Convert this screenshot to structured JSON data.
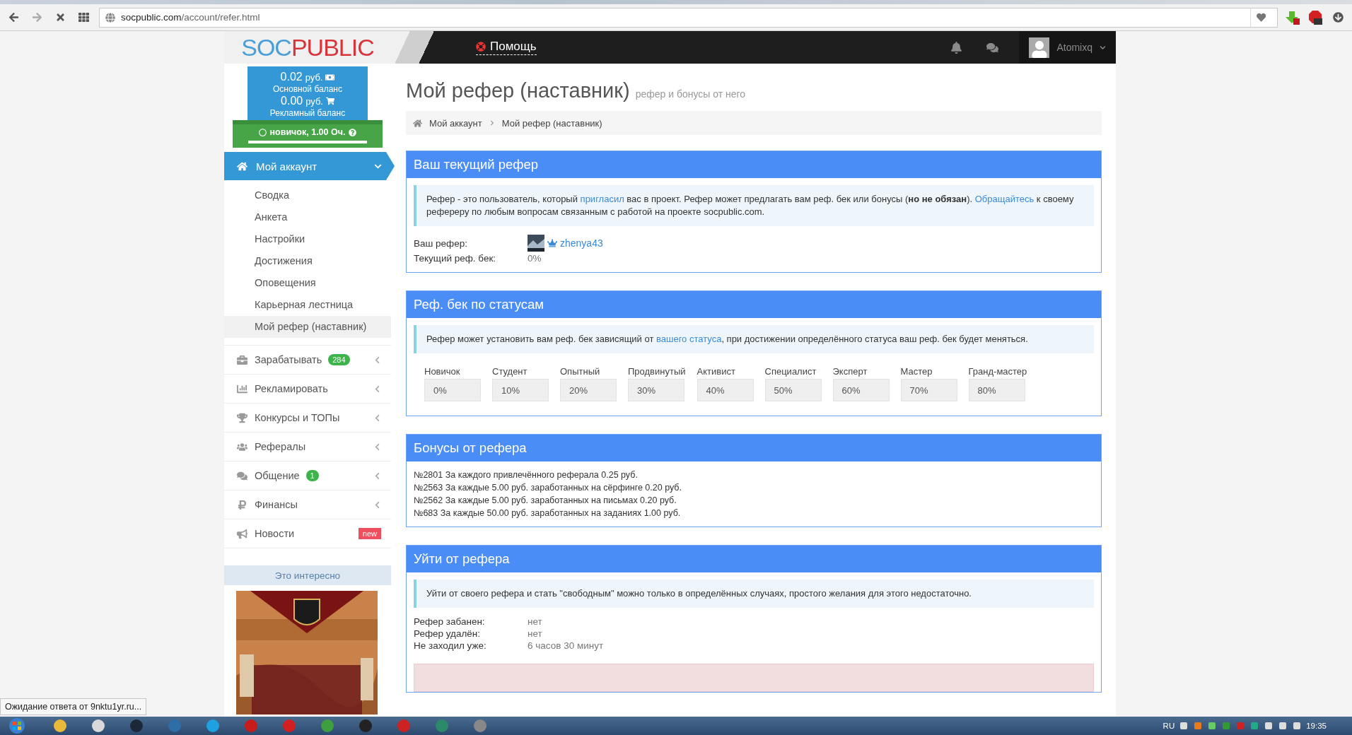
{
  "browser": {
    "url_host": "socpublic.com",
    "url_path": "/account/refer.html",
    "status_text": "Ожидание ответа от 9nktu1yr.ru..."
  },
  "header": {
    "logo_left": "SOC",
    "logo_right": "PUBLIC",
    "help": "Помощь",
    "user": "Atomixq"
  },
  "balance": {
    "main_amount": "0.02",
    "main_currency": "руб.",
    "main_label": "Основной баланс",
    "ad_amount": "0.00",
    "ad_currency": "руб.",
    "ad_label": "Рекламный баланс",
    "status": "новичок, 1.00 Оч.",
    "level": 1
  },
  "menu": {
    "account": {
      "label": "Мой аккаунт",
      "expanded": true
    },
    "subitems": [
      {
        "label": "Сводка",
        "selected": false
      },
      {
        "label": "Анкета",
        "selected": false
      },
      {
        "label": "Настройки",
        "selected": false
      },
      {
        "label": "Достижения",
        "selected": false
      },
      {
        "label": "Оповещения",
        "selected": false
      },
      {
        "label": "Карьерная лестница",
        "selected": false
      },
      {
        "label": "Мой рефер (наставник)",
        "selected": true
      }
    ],
    "items": [
      {
        "label": "Зарабатывать",
        "badge": {
          "text": "284",
          "kind": "count"
        },
        "has_submenu": true
      },
      {
        "label": "Рекламировать",
        "has_submenu": true
      },
      {
        "label": "Конкурсы и ТОПы",
        "has_submenu": true
      },
      {
        "label": "Рефералы",
        "has_submenu": true
      },
      {
        "label": "Общение",
        "badge": {
          "text": "1",
          "kind": "count"
        },
        "has_submenu": true
      },
      {
        "label": "Финансы",
        "has_submenu": true
      },
      {
        "label": "Новости",
        "badge": {
          "text": "new",
          "kind": "new"
        },
        "has_submenu": false
      }
    ]
  },
  "interest": {
    "title": "Это интересно"
  },
  "page": {
    "title": "Мой рефер (наставник)",
    "subtitle": "рефер и бонусы от него",
    "breadcrumb": [
      "Мой аккаунт",
      "Мой рефер (наставник)"
    ]
  },
  "panels": [
    {
      "title": "Ваш текущий рефер",
      "note": [
        {
          "kind": "text",
          "text": "Рефер - это пользователь, который "
        },
        {
          "kind": "link",
          "text": "пригласил"
        },
        {
          "kind": "text",
          "text": " вас в проект. Рефер может предлагать вам реф. бек или бонусы ("
        },
        {
          "kind": "bold",
          "text": "но не обязан"
        },
        {
          "kind": "text",
          "text": "). "
        },
        {
          "kind": "link",
          "text": "Обращайтесь"
        },
        {
          "kind": "text",
          "text": " к своему рефереру по любым вопросам связанным с работой на проекте socpublic.com."
        }
      ],
      "fields": [
        {
          "label": "Ваш рефер:",
          "value": "zhenya43",
          "kind": "user"
        },
        {
          "label": "Текущий реф. бек:",
          "value": "0%",
          "kind": "text"
        }
      ]
    },
    {
      "title": "Реф. бек по статусам",
      "note": [
        {
          "kind": "text",
          "text": "Рефер может установить вам реф. бек зависящий от "
        },
        {
          "kind": "link",
          "text": "вашего статуса"
        },
        {
          "kind": "text",
          "text": ", при достижении определённого статуса ваш реф. бек будет меняться."
        }
      ],
      "statuses": [
        {
          "name": "Новичок",
          "value": "0%"
        },
        {
          "name": "Студент",
          "value": "10%"
        },
        {
          "name": "Опытный",
          "value": "20%"
        },
        {
          "name": "Продвинутый",
          "value": "30%"
        },
        {
          "name": "Активист",
          "value": "40%"
        },
        {
          "name": "Специалист",
          "value": "50%"
        },
        {
          "name": "Эксперт",
          "value": "60%"
        },
        {
          "name": "Мастер",
          "value": "70%"
        },
        {
          "name": "Гранд-мастер",
          "value": "80%"
        }
      ]
    },
    {
      "title": "Бонусы от рефера",
      "bonuses": [
        "№2801 За каждого привлечённого реферала 0.25 руб.",
        "№2563 За каждые 5.00 руб. заработанных на сёрфинге 0.20 руб.",
        "№2562 За каждые 5.00 руб. заработанных на письмах 0.20 руб.",
        "№683 За каждые 50.00 руб. заработанных на заданиях 1.00 руб."
      ]
    },
    {
      "title": "Уйти от рефера",
      "note": [
        {
          "kind": "text",
          "text": "Уйти от своего рефера и стать \"свободным\" можно только в определённых случаях, простого желания для этого недостаточно."
        }
      ],
      "fields": [
        {
          "label": "Рефер забанен:",
          "value": "нет",
          "kind": "text"
        },
        {
          "label": "Рефер удалён:",
          "value": "нет",
          "kind": "text"
        },
        {
          "label": "Не заходил уже:",
          "value": "6 часов 30 минут",
          "kind": "text"
        }
      ],
      "alert": true
    }
  ],
  "taskbar": {
    "language": "RU",
    "time": "19:35"
  }
}
